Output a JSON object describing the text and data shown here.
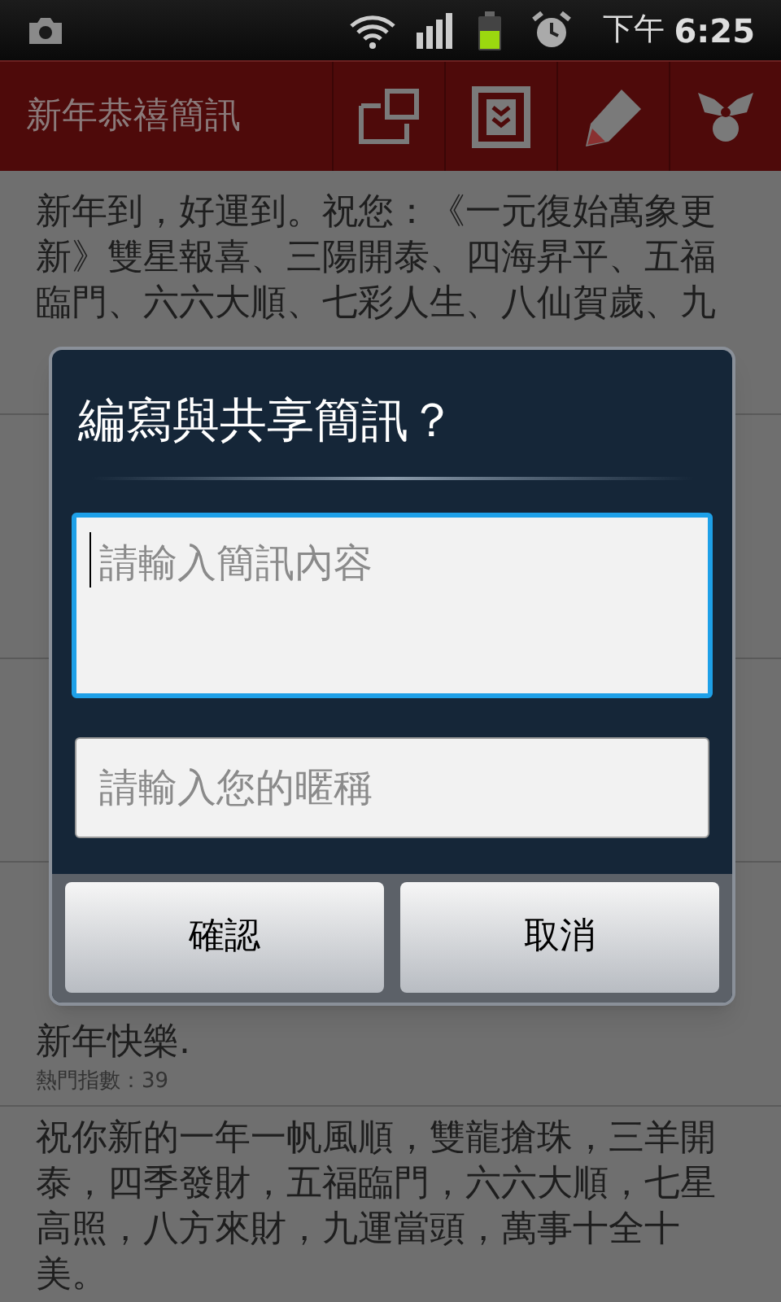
{
  "status_bar": {
    "period": "下午",
    "time": "6:25"
  },
  "action_bar": {
    "title": "新年恭禧簡訊"
  },
  "messages": [
    {
      "lines": [
        "新年到，好運到。祝您：《一元復始萬象更",
        "新》雙星報喜、三陽開泰、四海昇平、五福",
        "臨門、六六大順、七彩人生、八仙賀歲、九"
      ]
    },
    {
      "lines": [
        "新年快樂."
      ],
      "hot_index": "熱門指數：39"
    },
    {
      "lines": [
        "祝你新的一年一帆風順，雙龍搶珠，三羊開",
        "泰，四季發財，五福臨門，六六大順，七星",
        "高照，八方來財，九運當頭，萬事十全十",
        "美。"
      ]
    }
  ],
  "dialog": {
    "title": "編寫與共享簡訊？",
    "content_field": {
      "placeholder": "請輸入簡訊內容",
      "focused": true
    },
    "nickname_field": {
      "placeholder": "請輸入您的暱稱",
      "focused": false
    },
    "buttons": [
      "確認",
      "取消"
    ]
  }
}
